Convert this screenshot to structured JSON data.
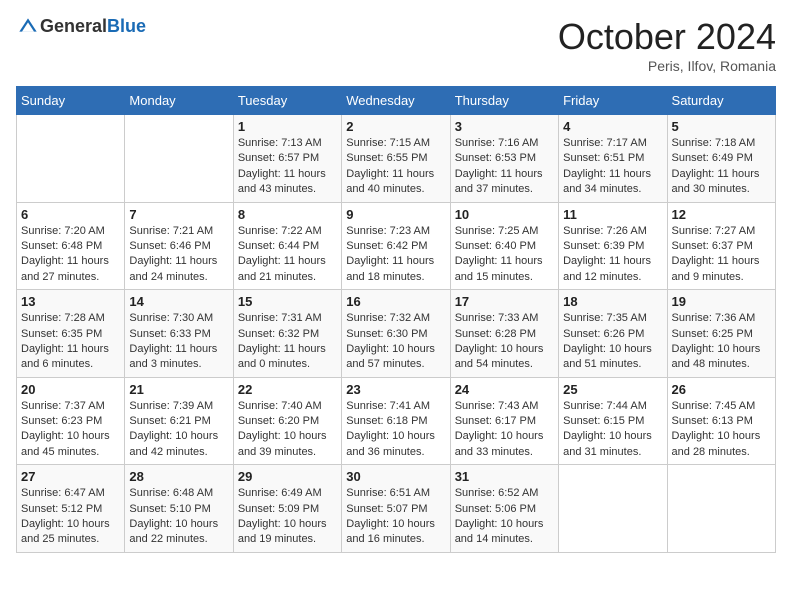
{
  "header": {
    "logo_general": "General",
    "logo_blue": "Blue",
    "title": "October 2024",
    "location": "Peris, Ilfov, Romania"
  },
  "days_of_week": [
    "Sunday",
    "Monday",
    "Tuesday",
    "Wednesday",
    "Thursday",
    "Friday",
    "Saturday"
  ],
  "weeks": [
    [
      {
        "day": "",
        "info": ""
      },
      {
        "day": "",
        "info": ""
      },
      {
        "day": "1",
        "info": "Sunrise: 7:13 AM\nSunset: 6:57 PM\nDaylight: 11 hours and 43 minutes."
      },
      {
        "day": "2",
        "info": "Sunrise: 7:15 AM\nSunset: 6:55 PM\nDaylight: 11 hours and 40 minutes."
      },
      {
        "day": "3",
        "info": "Sunrise: 7:16 AM\nSunset: 6:53 PM\nDaylight: 11 hours and 37 minutes."
      },
      {
        "day": "4",
        "info": "Sunrise: 7:17 AM\nSunset: 6:51 PM\nDaylight: 11 hours and 34 minutes."
      },
      {
        "day": "5",
        "info": "Sunrise: 7:18 AM\nSunset: 6:49 PM\nDaylight: 11 hours and 30 minutes."
      }
    ],
    [
      {
        "day": "6",
        "info": "Sunrise: 7:20 AM\nSunset: 6:48 PM\nDaylight: 11 hours and 27 minutes."
      },
      {
        "day": "7",
        "info": "Sunrise: 7:21 AM\nSunset: 6:46 PM\nDaylight: 11 hours and 24 minutes."
      },
      {
        "day": "8",
        "info": "Sunrise: 7:22 AM\nSunset: 6:44 PM\nDaylight: 11 hours and 21 minutes."
      },
      {
        "day": "9",
        "info": "Sunrise: 7:23 AM\nSunset: 6:42 PM\nDaylight: 11 hours and 18 minutes."
      },
      {
        "day": "10",
        "info": "Sunrise: 7:25 AM\nSunset: 6:40 PM\nDaylight: 11 hours and 15 minutes."
      },
      {
        "day": "11",
        "info": "Sunrise: 7:26 AM\nSunset: 6:39 PM\nDaylight: 11 hours and 12 minutes."
      },
      {
        "day": "12",
        "info": "Sunrise: 7:27 AM\nSunset: 6:37 PM\nDaylight: 11 hours and 9 minutes."
      }
    ],
    [
      {
        "day": "13",
        "info": "Sunrise: 7:28 AM\nSunset: 6:35 PM\nDaylight: 11 hours and 6 minutes."
      },
      {
        "day": "14",
        "info": "Sunrise: 7:30 AM\nSunset: 6:33 PM\nDaylight: 11 hours and 3 minutes."
      },
      {
        "day": "15",
        "info": "Sunrise: 7:31 AM\nSunset: 6:32 PM\nDaylight: 11 hours and 0 minutes."
      },
      {
        "day": "16",
        "info": "Sunrise: 7:32 AM\nSunset: 6:30 PM\nDaylight: 10 hours and 57 minutes."
      },
      {
        "day": "17",
        "info": "Sunrise: 7:33 AM\nSunset: 6:28 PM\nDaylight: 10 hours and 54 minutes."
      },
      {
        "day": "18",
        "info": "Sunrise: 7:35 AM\nSunset: 6:26 PM\nDaylight: 10 hours and 51 minutes."
      },
      {
        "day": "19",
        "info": "Sunrise: 7:36 AM\nSunset: 6:25 PM\nDaylight: 10 hours and 48 minutes."
      }
    ],
    [
      {
        "day": "20",
        "info": "Sunrise: 7:37 AM\nSunset: 6:23 PM\nDaylight: 10 hours and 45 minutes."
      },
      {
        "day": "21",
        "info": "Sunrise: 7:39 AM\nSunset: 6:21 PM\nDaylight: 10 hours and 42 minutes."
      },
      {
        "day": "22",
        "info": "Sunrise: 7:40 AM\nSunset: 6:20 PM\nDaylight: 10 hours and 39 minutes."
      },
      {
        "day": "23",
        "info": "Sunrise: 7:41 AM\nSunset: 6:18 PM\nDaylight: 10 hours and 36 minutes."
      },
      {
        "day": "24",
        "info": "Sunrise: 7:43 AM\nSunset: 6:17 PM\nDaylight: 10 hours and 33 minutes."
      },
      {
        "day": "25",
        "info": "Sunrise: 7:44 AM\nSunset: 6:15 PM\nDaylight: 10 hours and 31 minutes."
      },
      {
        "day": "26",
        "info": "Sunrise: 7:45 AM\nSunset: 6:13 PM\nDaylight: 10 hours and 28 minutes."
      }
    ],
    [
      {
        "day": "27",
        "info": "Sunrise: 6:47 AM\nSunset: 5:12 PM\nDaylight: 10 hours and 25 minutes."
      },
      {
        "day": "28",
        "info": "Sunrise: 6:48 AM\nSunset: 5:10 PM\nDaylight: 10 hours and 22 minutes."
      },
      {
        "day": "29",
        "info": "Sunrise: 6:49 AM\nSunset: 5:09 PM\nDaylight: 10 hours and 19 minutes."
      },
      {
        "day": "30",
        "info": "Sunrise: 6:51 AM\nSunset: 5:07 PM\nDaylight: 10 hours and 16 minutes."
      },
      {
        "day": "31",
        "info": "Sunrise: 6:52 AM\nSunset: 5:06 PM\nDaylight: 10 hours and 14 minutes."
      },
      {
        "day": "",
        "info": ""
      },
      {
        "day": "",
        "info": ""
      }
    ]
  ]
}
